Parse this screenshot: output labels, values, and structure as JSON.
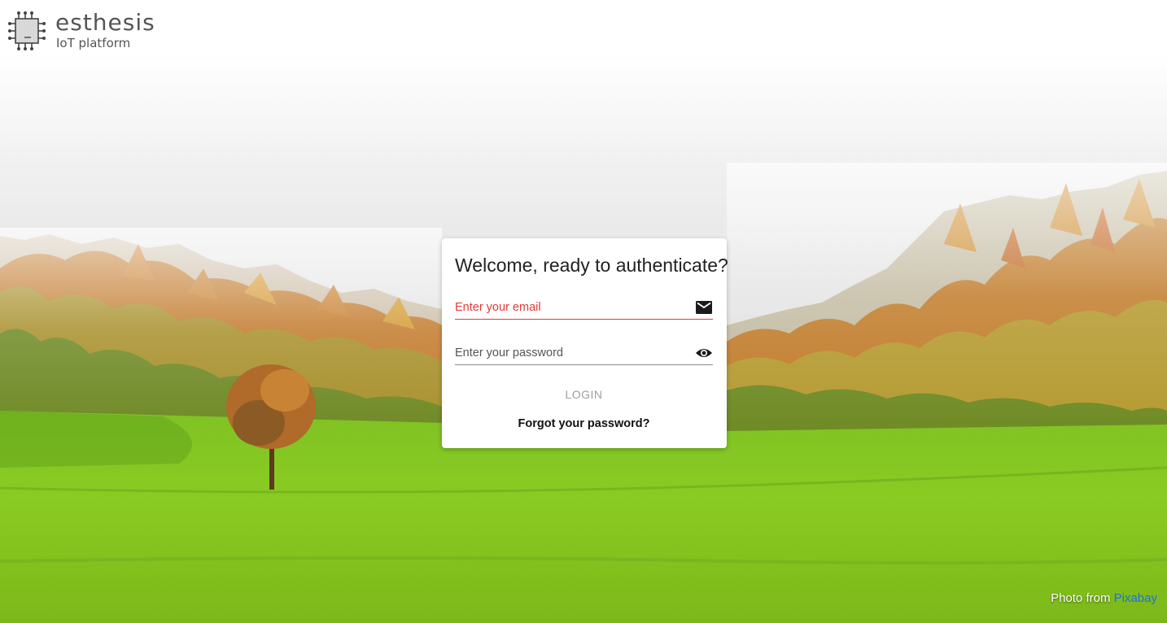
{
  "brand": {
    "name": "esthesis",
    "subtitle": "IoT platform",
    "icon": "chip-icon"
  },
  "login": {
    "title": "Welcome, ready to authenticate?",
    "email_placeholder": "Enter your email",
    "email_icon": "mail-icon",
    "password_placeholder": "Enter your password",
    "password_icon": "eye-icon",
    "login_label": "LOGIN",
    "forgot_label": "Forgot your password?"
  },
  "credit": {
    "prefix": "Photo from",
    "link_text": "Pixabay"
  },
  "colors": {
    "error_red": "#e53935",
    "link_blue": "#1e6fe0",
    "disabled_gray": "#9e9e9e",
    "grass_green": "#7cc320"
  }
}
